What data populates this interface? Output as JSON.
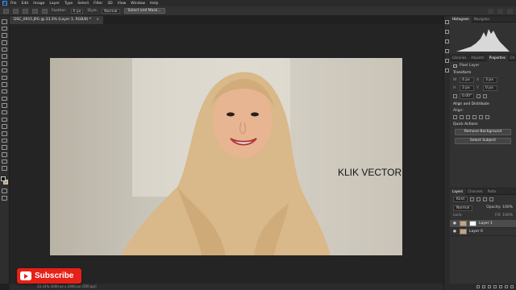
{
  "menubar": {
    "items": [
      "File",
      "Edit",
      "Image",
      "Layer",
      "Type",
      "Select",
      "Filter",
      "3D",
      "View",
      "Window",
      "Help"
    ]
  },
  "options_bar": {
    "feather_label": "Feather:",
    "feather_value": "0 px",
    "style_label": "Style:",
    "style_value": "Normal",
    "select_and_mask_label": "Select and Mask..."
  },
  "document": {
    "tab_title": "DSC_0915.JPG @ 33.3% (Layer 1, RGB/8) *",
    "close_glyph": "×"
  },
  "canvas": {
    "annotation": "KLIK VECTOR MASK"
  },
  "overlay": {
    "subscribe_label": "Subscribe"
  },
  "status": {
    "text": "33.33%    3000 px x 2000 px (300 ppi)"
  },
  "panels": {
    "top_tabs": [
      "Histogram",
      "Navigator"
    ],
    "properties_tabs": [
      "Libraries",
      "Adjustm",
      "Properties",
      "Ch"
    ],
    "layer_type": "Pixel Layer",
    "transform_title": "Transform",
    "transform": {
      "w_label": "W",
      "w_value": "4 px",
      "x_label": "X",
      "x_value": "3 px",
      "h_label": "H",
      "h_value": "3 px",
      "y_label": "Y",
      "y_value": "0 px",
      "angle_value": "0.00°"
    },
    "align_title": "Align and Distribute",
    "align_label": "Align:",
    "quick_actions_title": "Quick Actions",
    "remove_bg_label": "Remove Background",
    "select_subject_label": "Select Subject",
    "layers_tabs": [
      "Layers",
      "Channels",
      "Paths"
    ],
    "kind_label": "Kind",
    "blend_mode": "Normal",
    "opacity_label": "Opacity:",
    "opacity_value": "100%",
    "lock_label": "Lock:",
    "fill_label": "Fill:",
    "fill_value": "100%",
    "layers": [
      {
        "name": "Layer 1",
        "selected": true
      },
      {
        "name": "Layer 0",
        "selected": false
      }
    ]
  }
}
